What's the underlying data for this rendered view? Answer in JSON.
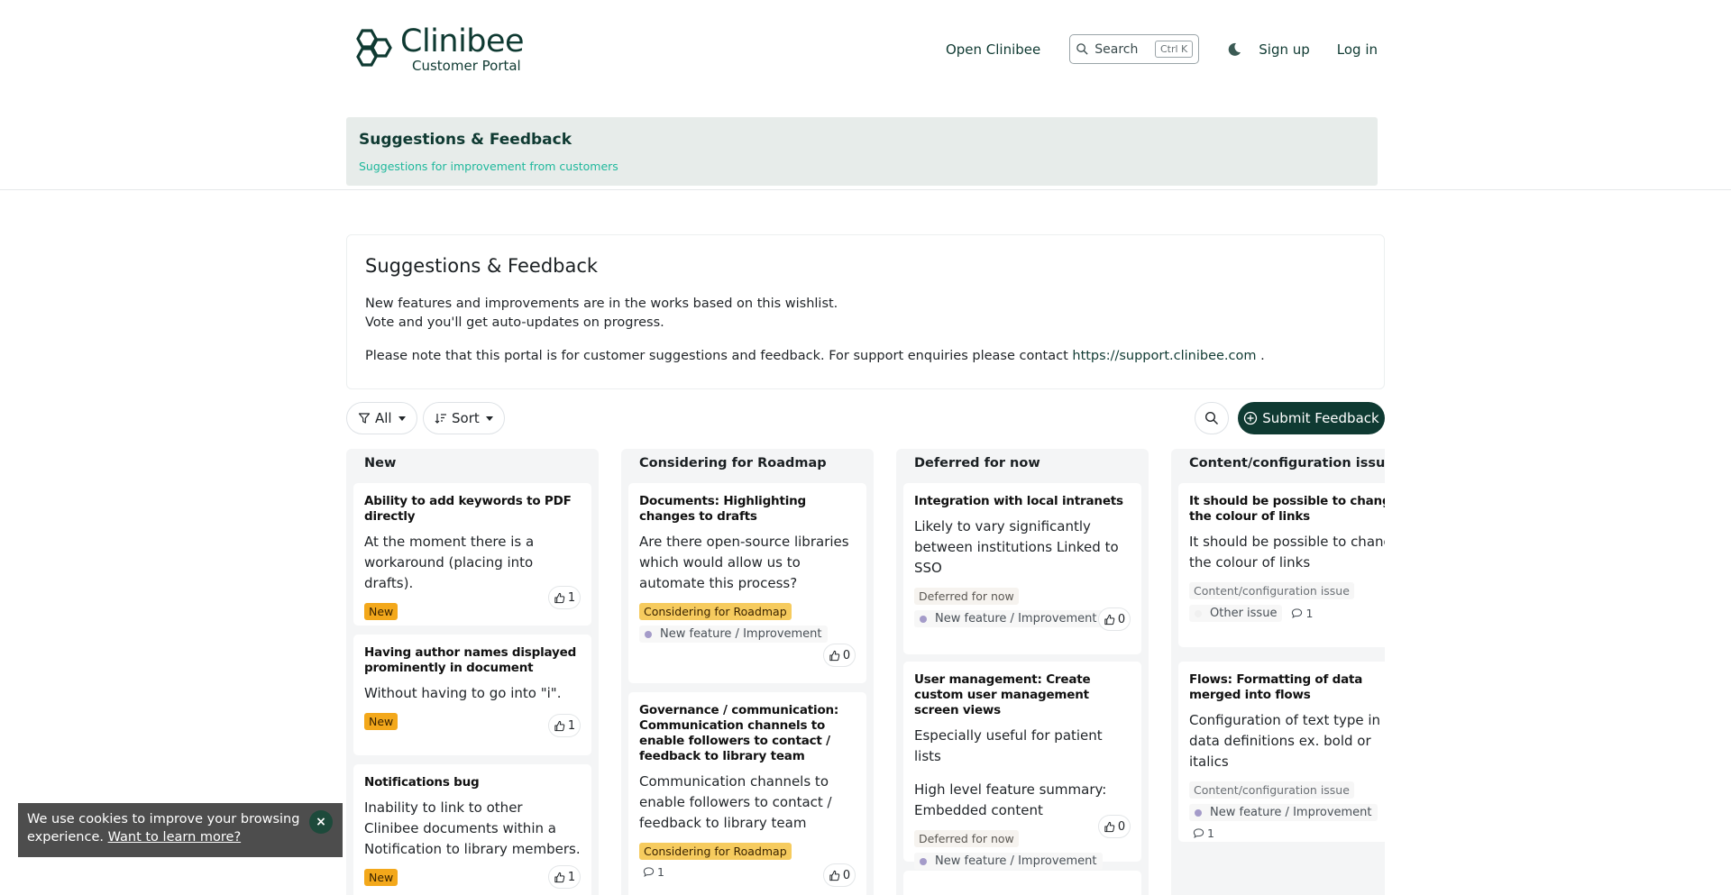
{
  "header": {
    "logo_name": "Clinibee",
    "logo_sub": "Customer Portal",
    "nav_open": "Open Clinibee",
    "search_label": "Search",
    "search_shortcut": "Ctrl K",
    "signup": "Sign up",
    "login": "Log in"
  },
  "banner": {
    "title": "Suggestions & Feedback",
    "subtitle": "Suggestions for improvement from customers"
  },
  "intro": {
    "title": "Suggestions & Feedback",
    "line1": "New features and improvements are in the works based on this wishlist.",
    "line2": "Vote and you'll get auto-updates on progress.",
    "line3_prefix": "Please note that this portal is for customer suggestions and feedback. For support enquiries please contact ",
    "line3_link": "https://support.clinibee.com",
    "line3_suffix": " ."
  },
  "toolbar": {
    "filter_label": "All",
    "sort_label": "Sort",
    "submit_label": "Submit Feedback"
  },
  "columns": [
    {
      "title": "New",
      "cards": [
        {
          "title": "Ability to add keywords to PDF directly",
          "desc": "At the moment there is a workaround (placing into drafts).",
          "badge": "New",
          "votes": "1"
        },
        {
          "title": "Having author names displayed prominently in document",
          "desc": "Without having to go into \"i\".",
          "badge": "New",
          "votes": "1"
        },
        {
          "title": "Notifications bug",
          "desc": "Inability to link to other Clinibee documents within a Notification to library members.",
          "badge": "New",
          "votes": "1"
        }
      ]
    },
    {
      "title": "Considering for Roadmap",
      "cards": [
        {
          "title": "Documents: Highlighting changes to drafts",
          "desc": "Are there open-source libraries which would allow us to automate this process?",
          "badge": "Considering for Roadmap",
          "category": "New feature / Improvement",
          "votes": "0"
        },
        {
          "title": "Governance / communication: Communication channels to enable followers to contact / feedback to library team",
          "desc": "Communication channels to enable followers to contact / feedback to library team",
          "badge": "Considering for Roadmap",
          "comments": "1",
          "votes": "0"
        }
      ]
    },
    {
      "title": "Deferred for now",
      "cards": [
        {
          "title": "Integration with local intranets",
          "desc": "Likely to vary significantly between institutions Linked to SSO",
          "badge": "Deferred for now",
          "category": "New feature / Improvement",
          "votes": "0"
        },
        {
          "title": "User management: Create custom user management screen views",
          "desc": "Especially useful for patient lists",
          "desc2": "High level feature summary: Embedded content",
          "badge": "Deferred for now",
          "category": "New feature / Improvement",
          "votes": "0"
        }
      ]
    },
    {
      "title": "Content/configuration issue",
      "cards": [
        {
          "title": "It should be possible to change the colour of links",
          "desc": "It should be possible to change the colour of links",
          "badge": "Content/configuration issue",
          "category": "Other issue",
          "comments": "1"
        },
        {
          "title": "Flows: Formatting of data merged into flows",
          "desc": "Configuration of text type in data definitions ex. bold or italics",
          "badge": "Content/configuration issue",
          "category": "New feature / Improvement",
          "comments": "1"
        }
      ]
    }
  ],
  "cookie": {
    "text": "We use cookies to improve your browsing experience. ",
    "link": "Want to learn more?",
    "close": "×"
  },
  "colors": {
    "brand": "#0f3a32",
    "accent_teal": "#1fb89c",
    "badge_new": "#f3a81b",
    "badge_roadmap": "#f6cb5e",
    "category_dot": "#a49bc9",
    "cookie_bg": "#4d4d4d"
  },
  "icons": [
    "hexagon-logo-icon",
    "search-icon",
    "moon-icon",
    "filter-icon",
    "sort-icon",
    "plus-circle-icon",
    "thumbs-up-icon",
    "comment-icon",
    "close-icon"
  ]
}
